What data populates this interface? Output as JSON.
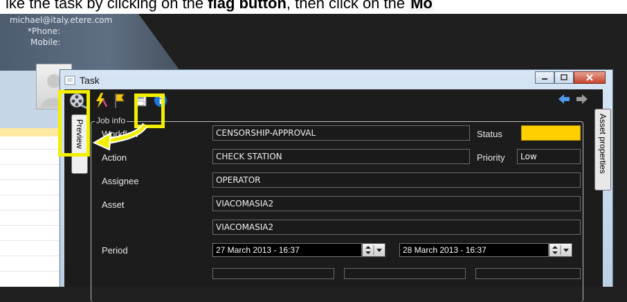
{
  "caption": {
    "prefix": "ike the task by clicking on the ",
    "bold": "flag button",
    "middle": ", then click on the ",
    "highlight": "Mo"
  },
  "background": {
    "email": "michael@italy.etere.com",
    "phone": "*Phone:",
    "mobile": "Mobile:"
  },
  "window": {
    "title": "Task"
  },
  "tabs": {
    "preview": "Preview",
    "asset_properties": "Asset properties"
  },
  "job": {
    "legend": "Job info",
    "workflow_label": "Workflow",
    "workflow_value": "CENSORSHIP-APPROVAL",
    "status_label": "Status",
    "action_label": "Action",
    "action_value": "CHECK STATION",
    "priority_label": "Priority",
    "priority_value": "Low",
    "assignee_label": "Assignee",
    "assignee_value": "OPERATOR",
    "asset_label": "Asset",
    "asset_value1": "VIACOMASIA2",
    "asset_value2": "VIACOMASIA2",
    "period_label": "Period",
    "period_start": "27 March 2013 - 16:37",
    "period_end": "28 March 2013 - 16:37"
  },
  "colors": {
    "status": "#ffd000",
    "highlight": "#f2f000"
  },
  "icons": [
    "note-icon",
    "film-reel-icon",
    "lightning-icon",
    "flag-icon",
    "save-icon",
    "info-icon",
    "back-arrow-icon",
    "forward-arrow-icon",
    "minimize-icon",
    "maximize-icon",
    "close-icon"
  ]
}
